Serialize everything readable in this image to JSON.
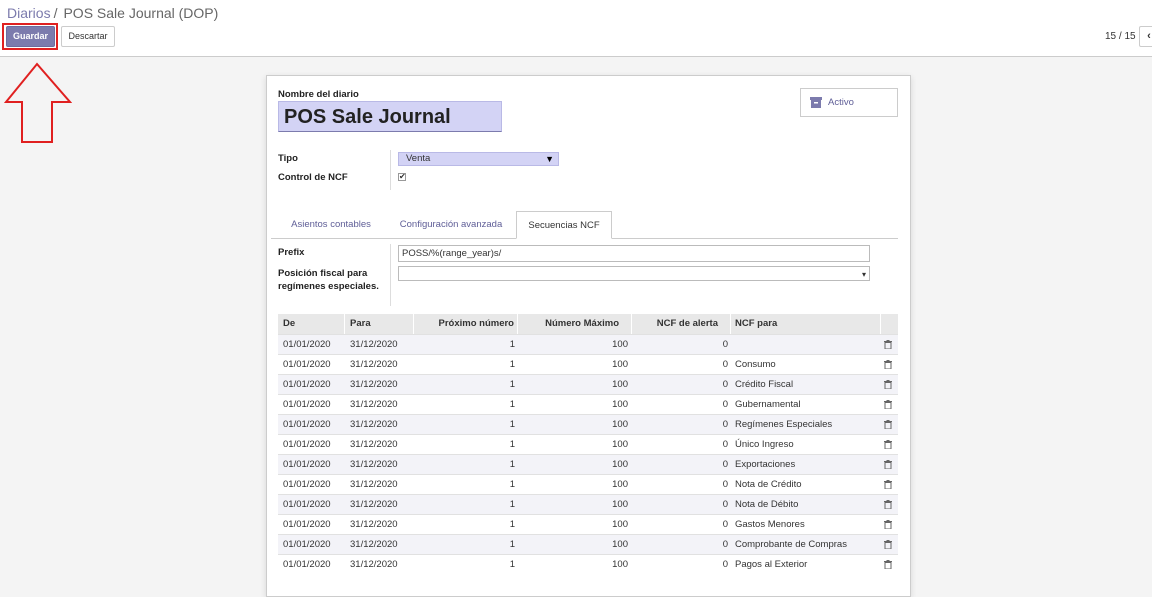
{
  "breadcrumb": {
    "parent": "Diarios",
    "separator": "/",
    "current": "POS Sale Journal (DOP)"
  },
  "toolbar": {
    "save_label": "Guardar",
    "discard_label": "Descartar"
  },
  "pager": {
    "value": "15 / 15",
    "prev_icon": "chevron-left-icon"
  },
  "form": {
    "name_label": "Nombre del diario",
    "name_value": "POS Sale Journal",
    "active_button_label": "Activo",
    "tipo_label": "Tipo",
    "tipo_value": "Venta",
    "control_ncf_label": "Control de NCF",
    "control_ncf_checked": true,
    "tabs": [
      {
        "label": "Asientos contables",
        "active": false
      },
      {
        "label": "Configuración avanzada",
        "active": false
      },
      {
        "label": "Secuencias NCF",
        "active": true
      }
    ],
    "prefix_label": "Prefix",
    "prefix_value": "POSS/%(range_year)s/",
    "fiscal_position_label": "Posición fiscal para regímenes especiales.",
    "fiscal_position_value": ""
  },
  "table": {
    "headers": [
      "De",
      "Para",
      "Próximo número",
      "Número Máximo",
      "NCF de alerta",
      "NCF para"
    ],
    "rows": [
      [
        "01/01/2020",
        "31/12/2020",
        "1",
        "100",
        "0",
        ""
      ],
      [
        "01/01/2020",
        "31/12/2020",
        "1",
        "100",
        "0",
        "Consumo"
      ],
      [
        "01/01/2020",
        "31/12/2020",
        "1",
        "100",
        "0",
        "Crédito Fiscal"
      ],
      [
        "01/01/2020",
        "31/12/2020",
        "1",
        "100",
        "0",
        "Gubernamental"
      ],
      [
        "01/01/2020",
        "31/12/2020",
        "1",
        "100",
        "0",
        "Regímenes Especiales"
      ],
      [
        "01/01/2020",
        "31/12/2020",
        "1",
        "100",
        "0",
        "Único Ingreso"
      ],
      [
        "01/01/2020",
        "31/12/2020",
        "1",
        "100",
        "0",
        "Exportaciones"
      ],
      [
        "01/01/2020",
        "31/12/2020",
        "1",
        "100",
        "0",
        "Nota de Crédito"
      ],
      [
        "01/01/2020",
        "31/12/2020",
        "1",
        "100",
        "0",
        "Nota de Débito"
      ],
      [
        "01/01/2020",
        "31/12/2020",
        "1",
        "100",
        "0",
        "Gastos Menores"
      ],
      [
        "01/01/2020",
        "31/12/2020",
        "1",
        "100",
        "0",
        "Comprobante de Compras"
      ],
      [
        "01/01/2020",
        "31/12/2020",
        "1",
        "100",
        "0",
        "Pagos al Exterior"
      ]
    ],
    "row_delete_icon": "trash-icon"
  },
  "colors": {
    "accent": "#7c7bad",
    "highlight": "#e02020",
    "input_required": "#d3d3f5"
  }
}
